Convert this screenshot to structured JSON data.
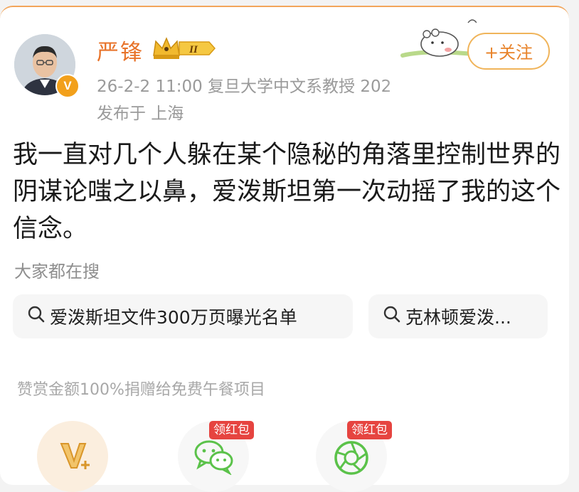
{
  "user": {
    "name": "严锋",
    "level_badge": "II",
    "verified_mark": "V"
  },
  "post": {
    "meta": "26-2-2 11:00  复旦大学中文系教授 202",
    "location": "发布于 上海",
    "text": "我一直对几个人躲在某个隐秘的角落里控制世界的阴谋论嗤之以鼻，爱泼斯坦第一次动摇了我的这个信念。"
  },
  "follow_button": "+关注",
  "trending": {
    "heading": "大家都在搜",
    "items": [
      "爱泼斯坦文件300万页曝光名单",
      "克林顿爱泼..."
    ]
  },
  "reward_note": "赞赏金额100%捐赠给免费午餐项目",
  "actions": {
    "redpacket_label": "领红包",
    "redpacket_label_2": "领红包"
  },
  "colors": {
    "accent_orange": "#e8732a",
    "follow_border": "#f0b45a",
    "redpacket_red": "#e64440",
    "wechat_green": "#5bc24a"
  },
  "icons": [
    "verified-v-icon",
    "level-crown-icon",
    "search-icon",
    "v-plus-icon",
    "wechat-icon",
    "moments-icon"
  ]
}
